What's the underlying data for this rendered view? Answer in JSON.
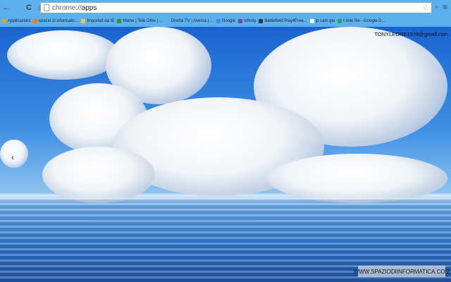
{
  "toolbar": {
    "url_prefix": "chrome://",
    "url_host": "apps",
    "back": "←",
    "forward": "→",
    "reload": "C",
    "home": "⌂",
    "star": "☆",
    "menu": "≡",
    "ext": "»"
  },
  "bookmarks": [
    {
      "label": "Applicazioni",
      "color": "#e6a020"
    },
    {
      "label": "spazio di informatic...",
      "color": "#f57d00"
    },
    {
      "label": "Importati da IE",
      "color": "#f3c64a"
    },
    {
      "label": "Home | Tele Oltre | ...",
      "color": "#3d8a3d"
    },
    {
      "label": "Diretta TV | Aversa | ...",
      "color": "transparent"
    },
    {
      "label": "Google",
      "color": "#4285f4"
    },
    {
      "label": "Infinity",
      "color": "#7b3fa6"
    },
    {
      "label": "Battlefield Play4Free...",
      "color": "#333"
    },
    {
      "label": "ip cam giu",
      "color": "#fff"
    },
    {
      "label": "I miei file - Google D...",
      "color": "#1fa463"
    }
  ],
  "content": {
    "user_email": "TONYLEONE1978@gmail.com",
    "prev_arrow": "‹",
    "watermark": "WWW.SPAZIODIINFORMATICA.COM"
  }
}
